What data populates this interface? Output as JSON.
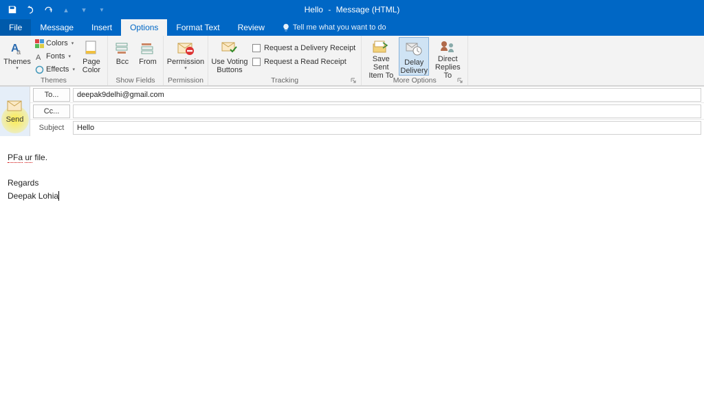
{
  "titlebar": {
    "doc_title": "Hello",
    "app_title": "Message (HTML)"
  },
  "tabs": {
    "file": "File",
    "message": "Message",
    "insert": "Insert",
    "options": "Options",
    "format_text": "Format Text",
    "review": "Review",
    "tell_me": "Tell me what you want to do"
  },
  "ribbon": {
    "themes": {
      "themes": "Themes",
      "colors": "Colors",
      "fonts": "Fonts",
      "effects": "Effects",
      "page_color": "Page\nColor",
      "group": "Themes"
    },
    "show_fields": {
      "bcc": "Bcc",
      "from": "From",
      "group": "Show Fields"
    },
    "permission": {
      "permission": "Permission",
      "group": "Permission"
    },
    "tracking": {
      "use_voting": "Use Voting\nButtons",
      "delivery_receipt": "Request a Delivery Receipt",
      "read_receipt": "Request a Read Receipt",
      "group": "Tracking"
    },
    "more_options": {
      "save_sent": "Save Sent\nItem To",
      "delay_delivery": "Delay\nDelivery",
      "direct_replies": "Direct\nReplies To",
      "group": "More Options"
    }
  },
  "compose": {
    "send": "Send",
    "to_label": "To...",
    "to_value": "deepak9delhi@gmail.com",
    "cc_label": "Cc...",
    "cc_value": "",
    "subject_label": "Subject",
    "subject_value": "Hello"
  },
  "body": {
    "line1_a": "PFa",
    "line1_b": "ur",
    "line1_c": " file.",
    "regards": "Regards",
    "signature": "Deepak Lohia"
  }
}
